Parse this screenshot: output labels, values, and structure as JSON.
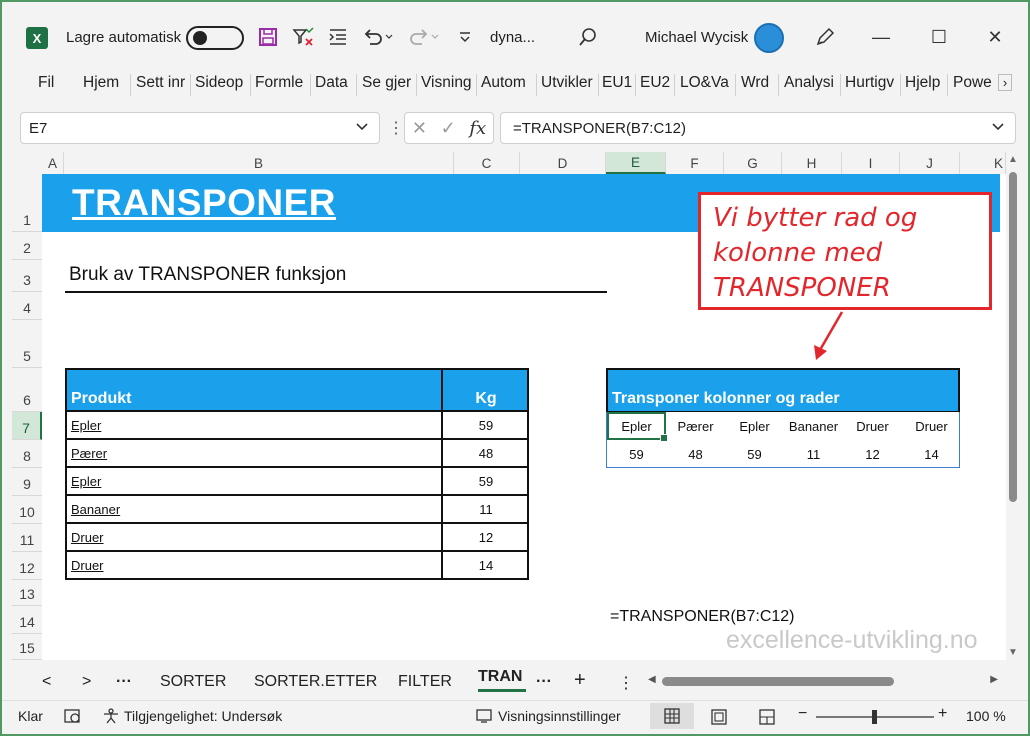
{
  "titlebar": {
    "autosave_label": "Lagre automatisk",
    "filename": "dyna...",
    "user": "Michael Wycisk",
    "minimize": "—",
    "maximize": "☐",
    "close": "✕"
  },
  "ribbon": {
    "tabs": [
      "Fil",
      "Hjem",
      "Sett inr",
      "Sideop",
      "Formle",
      "Data",
      "Se gjer",
      "Visning",
      "Autom",
      "Utvikler",
      "EU1",
      "EU2",
      "LO&Va",
      "Wrd",
      "Analysi",
      "Hurtigv",
      "Hjelp",
      "Powe"
    ]
  },
  "formula_bar": {
    "name_box": "E7",
    "formula": "=TRANSPONER(B7:C12)"
  },
  "grid": {
    "columns": [
      "A",
      "B",
      "C",
      "D",
      "E",
      "F",
      "G",
      "H",
      "I",
      "J",
      "K"
    ],
    "rows": [
      "1",
      "2",
      "3",
      "4",
      "5",
      "6",
      "7",
      "8",
      "9",
      "10",
      "11",
      "12",
      "13",
      "14",
      "15"
    ],
    "selected_column": "E",
    "selected_row": "7"
  },
  "sheet": {
    "banner_title": "TRANSPONER",
    "subtitle": "Bruk av TRANSPONER funksjon",
    "left_table": {
      "headers": [
        "Produkt",
        "Kg"
      ],
      "rows": [
        [
          "Epler",
          "59"
        ],
        [
          "Pærer",
          "48"
        ],
        [
          "Epler",
          "59"
        ],
        [
          "Bananer",
          "11"
        ],
        [
          "Druer",
          "12"
        ],
        [
          "Druer",
          "14"
        ]
      ]
    },
    "right_table": {
      "title": "Transponer kolonner og rader",
      "products": [
        "Epler",
        "Pærer",
        "Epler",
        "Bananer",
        "Druer",
        "Druer"
      ],
      "values": [
        "59",
        "48",
        "59",
        "11",
        "12",
        "14"
      ]
    },
    "formula_note": "=TRANSPONER(B7:C12)",
    "callout": [
      "Vi bytter rad og",
      "kolonne med",
      "TRANSPONER"
    ],
    "watermark": "excellence-utvikling.no",
    "callout_color": "#e3262b",
    "header_fill": "#1ba1ec"
  },
  "sheet_tabs": {
    "tabs": [
      "SORTER",
      "SORTER.ETTER",
      "FILTER"
    ],
    "active": "TRAN",
    "more": "···",
    "add": "+"
  },
  "statusbar": {
    "ready": "Klar",
    "accessibility": "Tilgjengelighet: Undersøk",
    "display_settings": "Visningsinnstillinger",
    "zoom": "100 %"
  }
}
